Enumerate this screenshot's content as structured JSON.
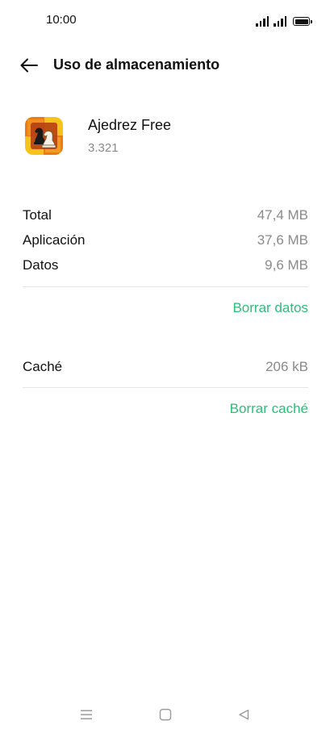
{
  "status_bar": {
    "time": "10:00"
  },
  "header": {
    "title": "Uso de almacenamiento",
    "back_icon": "arrow-left-icon"
  },
  "app": {
    "name": "Ajedrez Free",
    "version": "3.321",
    "icon": "chess-app-icon"
  },
  "storage": {
    "rows": [
      {
        "label": "Total",
        "value": "47,4 MB"
      },
      {
        "label": "Aplicación",
        "value": "37,6 MB"
      },
      {
        "label": "Datos",
        "value": "9,6 MB"
      }
    ],
    "clear_data_label": "Borrar datos"
  },
  "cache": {
    "label": "Caché",
    "value": "206 kB",
    "clear_cache_label": "Borrar caché"
  },
  "colors": {
    "accent": "#2bbf7a",
    "secondary_text": "#8a8a8a",
    "divider": "#e6e6e6"
  },
  "nav_bar": {
    "icons": [
      "menu-icon",
      "home-square-icon",
      "back-triangle-icon"
    ]
  }
}
